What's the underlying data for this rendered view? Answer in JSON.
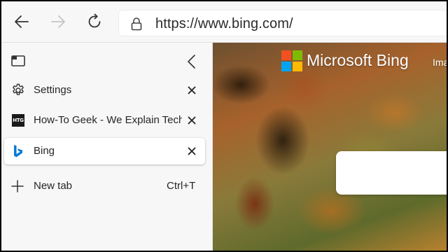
{
  "toolbar": {
    "back_icon": "back-arrow-icon",
    "forward_icon": "forward-arrow-icon",
    "refresh_icon": "refresh-icon",
    "url": "https://www.bing.com/"
  },
  "tabs_pane": {
    "header_icon": "tab-actions-icon",
    "collapse_icon": "chevron-left-icon",
    "tabs": [
      {
        "label": "Settings",
        "favicon": "gear-icon",
        "active": false
      },
      {
        "label": "How-To Geek - We Explain Technology",
        "favicon": "htg-logo-icon",
        "favicon_text": "HTG",
        "active": false
      },
      {
        "label": "Bing",
        "favicon": "bing-icon",
        "active": true
      }
    ],
    "new_tab": {
      "label": "New tab",
      "shortcut": "Ctrl+T"
    }
  },
  "page": {
    "brand": "Microsoft Bing",
    "images_link": "Images"
  },
  "colors": {
    "toolbar_bg": "#f7f7f7",
    "bing_blue": "#0078d4",
    "ms_red": "#f25022",
    "ms_green": "#7fba00",
    "ms_blue": "#00a4ef",
    "ms_yellow": "#ffb900"
  }
}
